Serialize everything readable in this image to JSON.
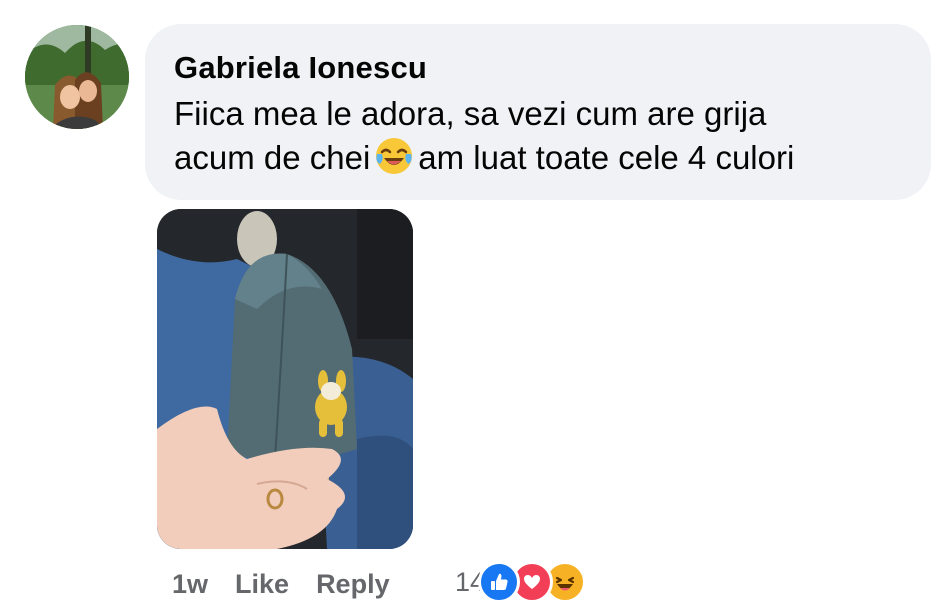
{
  "comment": {
    "author": "Gabriela Ionescu",
    "text_line1": "Fiica mea le adora, sa vezi cum are grija",
    "text_line2_before": "acum de chei",
    "emoji_name": "face-with-tears-of-joy",
    "text_line2_after": "am luat toate cele 4 culori"
  },
  "actions": {
    "time": "1w",
    "like_label": "Like",
    "reply_label": "Reply"
  },
  "reactions": {
    "count": "14",
    "types": [
      "like",
      "love",
      "haha"
    ]
  },
  "colors": {
    "bubble_bg": "#f0f2f5",
    "meta_text": "#65676b",
    "like_blue": "#1877f2",
    "love_red": "#f33e58",
    "haha_yellow": "#f7b125"
  }
}
